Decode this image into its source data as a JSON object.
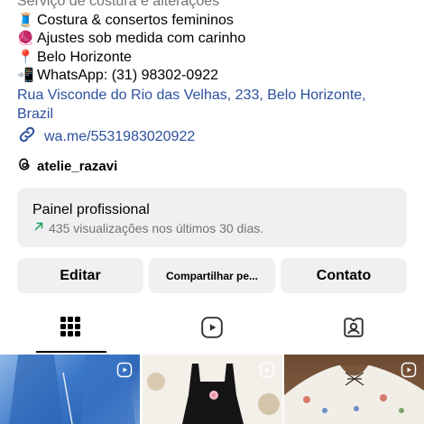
{
  "profile": {
    "category_line": "Serviço de costura e alterações",
    "bio_lines": [
      {
        "emoji": "🧵",
        "text": "Costura & consertos femininos"
      },
      {
        "emoji": "🧶",
        "text": "Ajustes sob medida com carinho"
      },
      {
        "emoji": "📍",
        "text": "Belo Horizonte"
      },
      {
        "emoji": "📲",
        "text": "WhatsApp: (31) 98302-0922"
      }
    ],
    "address": "Rua Visconde do Rio das Velhas, 233, Belo Horizonte, Brazil",
    "link": "wa.me/5531983020922",
    "threads_handle": "atelie_razavi"
  },
  "dashboard": {
    "title": "Painel profissional",
    "stats": "435 visualizações nos últimos 30 dias."
  },
  "actions": {
    "edit": "Editar",
    "share": "Compartilhar pe...",
    "contact": "Contato"
  },
  "tabs": {
    "active": "grid",
    "icons": [
      "grid-icon",
      "reels-icon",
      "tagged-icon"
    ]
  },
  "colors": {
    "link": "#2b4f9e",
    "panel_bg": "#eff0f2",
    "muted": "#737373",
    "arrow": "#1a9e5a"
  }
}
